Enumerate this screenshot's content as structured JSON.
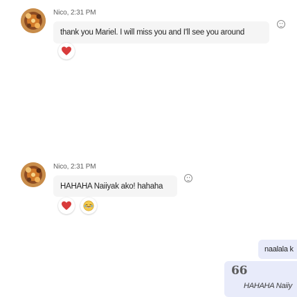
{
  "messages": [
    {
      "sender": "Nico",
      "time": "2:31 PM",
      "meta": "Nico, 2:31 PM",
      "text": "thank you Mariel. I will miss you and I'll see you around",
      "reactions": [
        "heart-icon"
      ]
    },
    {
      "sender": "Nico",
      "time": "2:31 PM",
      "meta": "Nico, 2:31 PM",
      "text": "HAHAHA Naiiyak ako! hahaha",
      "reactions": [
        "heart-icon",
        "cry-laugh-face-icon"
      ]
    }
  ],
  "outgoing": {
    "message_text": "naalala k",
    "quote_mark": "66",
    "quoted_text": "HAHAHA Naiiy"
  },
  "colors": {
    "incoming_bubble": "#f5f5f5",
    "outgoing_bubble": "#e8ebfa",
    "heart": "#d83b3b",
    "emoji_face": "#f2c94c"
  }
}
